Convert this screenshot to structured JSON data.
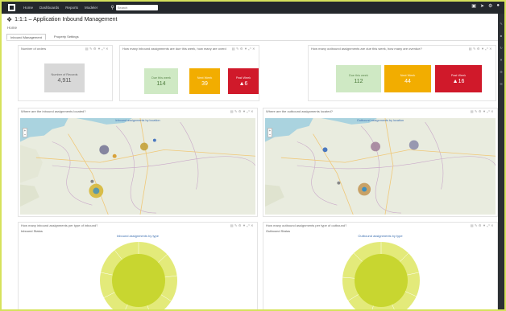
{
  "topbar": {
    "nav": [
      "Home",
      "Dashboards",
      "Reports",
      "Modeler"
    ],
    "search_placeholder": "Search"
  },
  "header": {
    "title": "1:1:1 – Application Inbound Management",
    "sublabel": "Home"
  },
  "tabs": [
    {
      "label": "Inbound Management",
      "active": true
    },
    {
      "label": "Property Settings",
      "active": false
    }
  ],
  "kpi_panels": {
    "total": {
      "title": "Number of orders",
      "box": {
        "label": "Number of Records",
        "value": "4,911",
        "color": "#d8d8d8"
      }
    },
    "inbound": {
      "title": "How many inbound assignments are due this week, how many are overdue?",
      "boxes": [
        {
          "label": "Due this week",
          "value": "114",
          "color": "#cfe9c4"
        },
        {
          "label": "Next Week",
          "value": "39",
          "color": "#f2ad00"
        },
        {
          "label": "Past Week",
          "value": "▲6",
          "color": "#d0192a"
        }
      ]
    },
    "outbound": {
      "title": "How many outbound assignments are due this week, how many are overdue?",
      "boxes": [
        {
          "label": "Due this week",
          "value": "112",
          "color": "#cfe9c4"
        },
        {
          "label": "Next Week",
          "value": "44",
          "color": "#f2ad00"
        },
        {
          "label": "Past Week",
          "value": "▲16",
          "color": "#d0192a"
        }
      ]
    }
  },
  "map_panels": [
    {
      "title": "Where are the inbound assignments located?",
      "map_title": "Inbound assignments by location"
    },
    {
      "title": "Where are the outbound assignments located?",
      "map_title": "Outbound assignments by location"
    }
  ],
  "donut_panels": [
    {
      "title": "How many inbound assignments per type of inbound?",
      "sub": "Inbound Status",
      "chart_title": "Inbound assignments by type"
    },
    {
      "title": "How many outbound assignments per type of outbound?",
      "sub": "Outbound Status",
      "chart_title": "Outbound assignments by type"
    }
  ],
  "colors": {
    "accent_border": "#d6e25c",
    "topbar_bg": "#24282c",
    "donut_fill": "#c8d630",
    "donut_ring": "#e3ea7a"
  }
}
